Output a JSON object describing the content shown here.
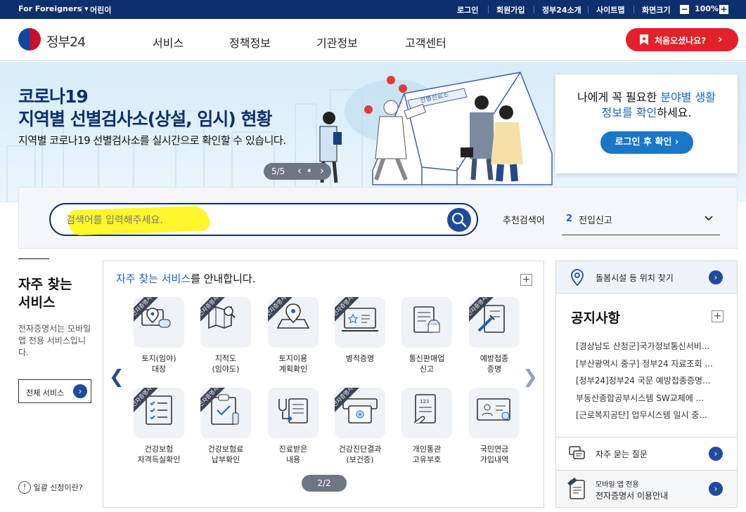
{
  "topbar": {
    "foreigners": "For Foreigners ▾",
    "kids": "어린이",
    "login": "로그인",
    "join": "회원가입",
    "about": "정부24소개",
    "sitemap": "사이트맵",
    "screen_size": "화면크기",
    "zoom_minus": "−",
    "zoom_value": "100%",
    "zoom_plus": "+"
  },
  "header": {
    "logo_text": "정부24",
    "nav": [
      "서비스",
      "정책정보",
      "기관정보",
      "고객센터"
    ],
    "first_visit": "처음오셨나요?",
    "first_visit_arrow": "›"
  },
  "banner": {
    "title_line1": "코로나19",
    "title_line2": "지역별 선별검사소(상설, 임시) 현황",
    "subtitle": "지역별 코로나19 선별검사소를 실시간으로 확인할 수 있습니다.",
    "tent_sign": "선별진료소",
    "pager": "5/5",
    "pager_prev": "‹",
    "pager_pause": "⏸",
    "pager_next": "›",
    "info_before": "나에게 꼭 필요한 ",
    "info_hl1": "분야별 생활",
    "info_hl2": "정보를 확인",
    "info_after": "하세요.",
    "login_check": "로그인 후 확인 ›"
  },
  "search": {
    "placeholder": "검색어를 입력해주세요.",
    "recommend_label": "추천검색어",
    "recommend_number": "2",
    "recommend_word": "전입신고"
  },
  "faq_side": {
    "title_line1": "자주 찾는",
    "title_line2": "서비스",
    "desc": "전자증명서는 모바일 앱 전용 서비스입니다.",
    "all_services": "전체 서비스",
    "apply_link": "일괄 신청이란?"
  },
  "services_panel": {
    "title_hl": "자주 찾는 서비스",
    "title_rest": "를 안내합니다.",
    "plus": "+",
    "tag": "전자증명서",
    "items": [
      {
        "line1": "토지(임야)",
        "line2": "대장",
        "icon": "land-map-icon"
      },
      {
        "line1": "지적도",
        "line2": "(임야도)",
        "icon": "folded-map-icon"
      },
      {
        "line1": "토지이용",
        "line2": "계획확인",
        "icon": "location-map-icon"
      },
      {
        "line1": "병적증명",
        "line2": "",
        "icon": "laptop-star-icon"
      },
      {
        "line1": "통신판매업",
        "line2": "신고",
        "icon": "store-document-icon"
      },
      {
        "line1": "예방접종",
        "line2": "증명",
        "icon": "syringe-document-icon"
      },
      {
        "line1": "건강보험",
        "line2": "자격득실확인",
        "icon": "checklist-icon"
      },
      {
        "line1": "건강보험료",
        "line2": "납부확인",
        "icon": "clipboard-check-icon"
      },
      {
        "line1": "진료받은",
        "line2": "내용",
        "icon": "stethoscope-icon"
      },
      {
        "line1": "건강진단결과",
        "line2": "(보건증)",
        "icon": "health-card-icon"
      },
      {
        "line1": "개인통관",
        "line2": "고유부호",
        "icon": "customs-document-icon"
      },
      {
        "line1": "국민연금",
        "line2": "가입내역",
        "icon": "pension-monitor-icon"
      }
    ],
    "page": "2/2"
  },
  "right": {
    "facility_search": "돌봄시설 등 위치 찾기",
    "notice_title": "공지사항",
    "notices": [
      "[경상남도 산청군]국가정보통신서비...",
      "[부산광역시 중구] 정부24 자료조회 ...",
      "[정부24]정부24 국문 예방접종증명...",
      "부동산종합공부시스템 SW교체에 ...",
      "[근로복지공단] 업무시스템 일시 중..."
    ],
    "faq": "자주 묻는 질문",
    "mobile_line1": "모바일 앱 전용",
    "mobile_line2": "전자증명서 이용안내",
    "go": "›"
  },
  "colors": {
    "navy": "#0d2f6e",
    "red": "#e2212a",
    "blue": "#1565c0",
    "highlight": "#fff72b"
  }
}
